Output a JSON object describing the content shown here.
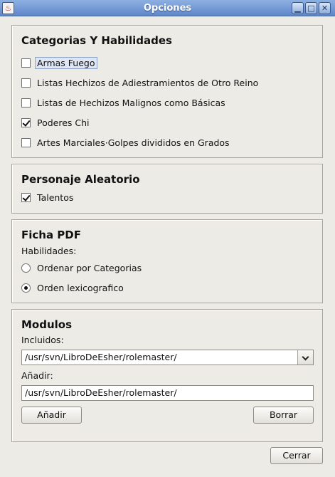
{
  "window": {
    "title": "Opciones",
    "app_icon": "java-icon",
    "controls": [
      "minimize-icon",
      "maximize-icon",
      "close-icon"
    ]
  },
  "categorias": {
    "title": "Categorias Y Habilidades",
    "items": [
      {
        "label": "Armas Fuego",
        "checked": false
      },
      {
        "label": "Listas Hechizos de Adiestramientos de Otro Reino",
        "checked": false
      },
      {
        "label": "Listas de Hechizos Malignos como Básicas",
        "checked": false
      },
      {
        "label": "Poderes Chi",
        "checked": true
      },
      {
        "label": "Artes Marciales·Golpes divididos en Grados",
        "checked": false
      }
    ]
  },
  "personaje": {
    "title": "Personaje Aleatorio",
    "items": [
      {
        "label": "Talentos",
        "checked": true
      }
    ]
  },
  "ficha": {
    "title": "Ficha PDF",
    "habilidades_label": "Habilidades:",
    "options": [
      {
        "label": "Ordenar por Categorias",
        "selected": false
      },
      {
        "label": "Orden lexicografico",
        "selected": true
      }
    ]
  },
  "modulos": {
    "title": "Modulos",
    "incluidos_label": "Incluidos:",
    "incluidos_value": "/usr/svn/LibroDeEsher/rolemaster/",
    "anadir_label": "Añadir:",
    "anadir_value": "/usr/svn/LibroDeEsher/rolemaster/",
    "anadir_button": "Añadir",
    "borrar_button": "Borrar"
  },
  "cerrar_button": "Cerrar"
}
